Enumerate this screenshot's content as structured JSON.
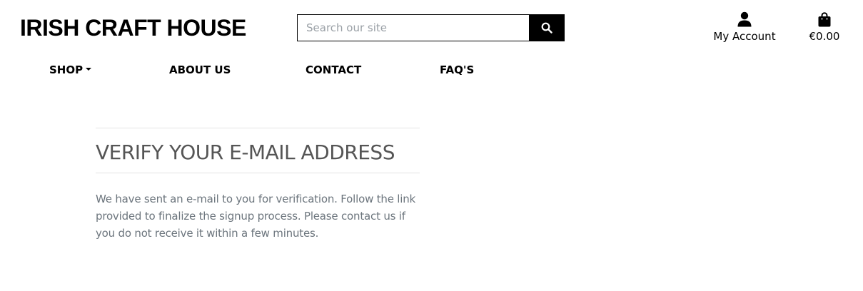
{
  "brand": {
    "name": "IRISH CRAFT HOUSE"
  },
  "search": {
    "placeholder": "Search our site",
    "value": "",
    "button_icon": "search-icon"
  },
  "account": {
    "label": "My Account",
    "icon": "user-icon"
  },
  "bag": {
    "total": "€0.00",
    "icon": "shopping-bag-icon"
  },
  "nav": {
    "items": [
      {
        "label": "SHOP",
        "has_dropdown": true
      },
      {
        "label": "ABOUT US"
      },
      {
        "label": "CONTACT"
      },
      {
        "label": "FAQ'S"
      }
    ]
  },
  "main": {
    "heading": "VERIFY YOUR E-MAIL ADDRESS",
    "message": "We have sent an e-mail to you for verification. Follow the link provided to finalize the signup process. Please contact us if you do not receive it within a few minutes."
  },
  "colors": {
    "text": "#000000",
    "heading": "#555555",
    "muted": "#6c757d",
    "rule": "#e4e4e4",
    "button_bg": "#000000"
  }
}
